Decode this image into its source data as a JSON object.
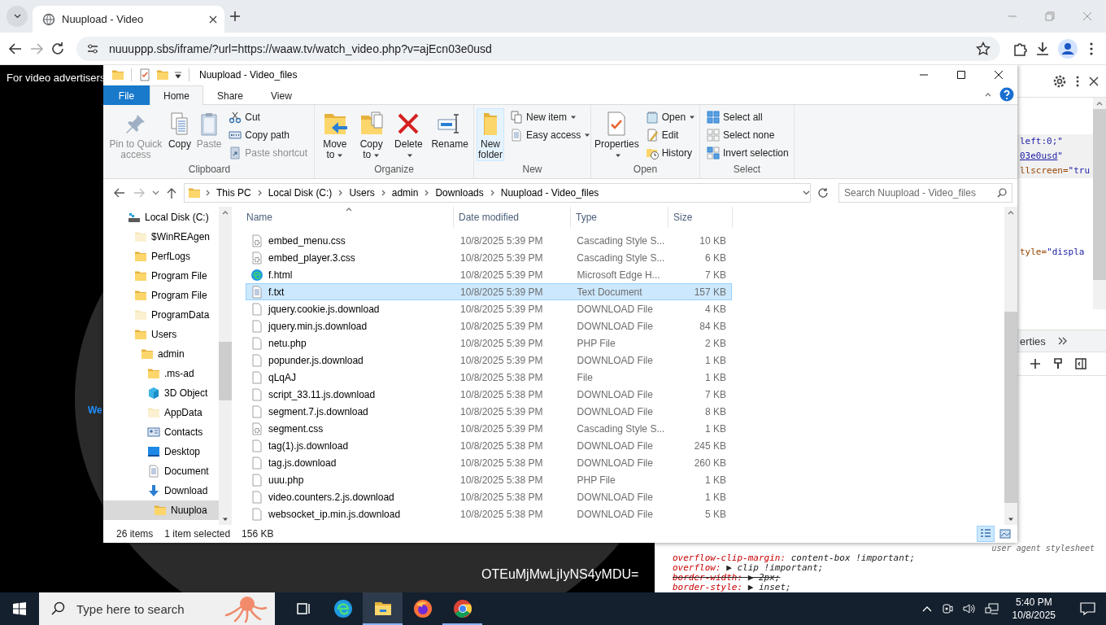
{
  "browser": {
    "tab": {
      "title": "Nuupload - Video"
    },
    "url": "nuuuppp.sbs/iframe/?url=https://waaw.tv/watch_video.php?v=ajEcn03e0usd"
  },
  "page": {
    "banner": "For video advertisers",
    "side_text": "We",
    "footer_code": "OTEuMjMwLjIyNS4yMDU="
  },
  "explorer": {
    "title": "Nuupload - Video_files",
    "tabs": [
      {
        "label": "File",
        "kind": "file",
        "selected": false
      },
      {
        "label": "Home",
        "kind": "normal",
        "selected": true
      },
      {
        "label": "Share",
        "kind": "normal",
        "selected": false
      },
      {
        "label": "View",
        "kind": "normal",
        "selected": false
      }
    ],
    "ribbon": [
      {
        "title": "Clipboard",
        "items": [
          {
            "label": "Pin to Quick access",
            "kind": "large",
            "disabled": true,
            "highlighted": false,
            "dropdown": false
          },
          {
            "label": "Copy",
            "kind": "large",
            "disabled": false,
            "highlighted": false,
            "dropdown": false
          },
          {
            "label": "Paste",
            "kind": "large",
            "disabled": true,
            "highlighted": false,
            "dropdown": false
          },
          {
            "label": "Cut",
            "kind": "small",
            "disabled": false,
            "highlighted": false,
            "dropdown": false
          },
          {
            "label": "Copy path",
            "kind": "small",
            "disabled": false,
            "highlighted": false,
            "dropdown": false
          },
          {
            "label": "Paste shortcut",
            "kind": "small",
            "disabled": true,
            "highlighted": false,
            "dropdown": false
          }
        ]
      },
      {
        "title": "Organize",
        "items": [
          {
            "label": "Move to",
            "kind": "large",
            "disabled": false,
            "highlighted": false,
            "dropdown": true
          },
          {
            "label": "Copy to",
            "kind": "large",
            "disabled": false,
            "highlighted": false,
            "dropdown": true
          },
          {
            "label": "Delete",
            "kind": "large",
            "disabled": false,
            "highlighted": false,
            "dropdown": true
          },
          {
            "label": "Rename",
            "kind": "large",
            "disabled": false,
            "highlighted": false,
            "dropdown": false
          }
        ]
      },
      {
        "title": "New",
        "items": [
          {
            "label": "New folder",
            "kind": "large",
            "disabled": false,
            "highlighted": true,
            "dropdown": false
          },
          {
            "label": "New item",
            "kind": "small",
            "disabled": false,
            "highlighted": false,
            "dropdown": true
          },
          {
            "label": "Easy access",
            "kind": "small",
            "disabled": false,
            "highlighted": false,
            "dropdown": true
          }
        ]
      },
      {
        "title": "Open",
        "items": [
          {
            "label": "Properties",
            "kind": "large",
            "disabled": false,
            "highlighted": false,
            "dropdown": true
          },
          {
            "label": "Open",
            "kind": "small",
            "disabled": false,
            "highlighted": false,
            "dropdown": true
          },
          {
            "label": "Edit",
            "kind": "small",
            "disabled": false,
            "highlighted": false,
            "dropdown": false
          },
          {
            "label": "History",
            "kind": "small",
            "disabled": false,
            "highlighted": false,
            "dropdown": false
          }
        ]
      },
      {
        "title": "Select",
        "items": [
          {
            "label": "Select all",
            "kind": "small",
            "disabled": false,
            "highlighted": false,
            "dropdown": false
          },
          {
            "label": "Select none",
            "kind": "small",
            "disabled": false,
            "highlighted": false,
            "dropdown": false
          },
          {
            "label": "Invert selection",
            "kind": "small",
            "disabled": false,
            "highlighted": false,
            "dropdown": false
          }
        ]
      }
    ],
    "breadcrumbs": [
      "This PC",
      "Local Disk (C:)",
      "Users",
      "admin",
      "Downloads",
      "Nuupload - Video_files"
    ],
    "search": {
      "placeholder": "Search Nuupload - Video_files"
    },
    "nav": [
      {
        "label": "Local Disk (C:)",
        "kind": "drive",
        "selected": false,
        "children": [
          {
            "label": "$WinREAgen",
            "kind": "hidden-folder",
            "selected": false
          },
          {
            "label": "PerfLogs",
            "kind": "folder",
            "selected": false
          },
          {
            "label": "Program File",
            "kind": "folder",
            "selected": false
          },
          {
            "label": "Program File",
            "kind": "folder",
            "selected": false
          },
          {
            "label": "ProgramData",
            "kind": "hidden-folder",
            "selected": false
          },
          {
            "label": "Users",
            "kind": "folder",
            "selected": false,
            "children": [
              {
                "label": "admin",
                "kind": "folder",
                "selected": false,
                "children": [
                  {
                    "label": ".ms-ad",
                    "kind": "folder",
                    "selected": false
                  },
                  {
                    "label": "3D Object",
                    "kind": "cube",
                    "selected": false
                  },
                  {
                    "label": "AppData",
                    "kind": "hidden-folder",
                    "selected": false
                  },
                  {
                    "label": "Contacts",
                    "kind": "contacts",
                    "selected": false
                  },
                  {
                    "label": "Desktop",
                    "kind": "desktop",
                    "selected": false
                  },
                  {
                    "label": "Document",
                    "kind": "documents",
                    "selected": false
                  },
                  {
                    "label": "Download",
                    "kind": "downloads",
                    "selected": false,
                    "children": [
                      {
                        "label": "Nuuploa",
                        "kind": "folder",
                        "selected": true
                      }
                    ]
                  }
                ]
              }
            ]
          }
        ]
      }
    ],
    "columns": [
      {
        "label": "Name",
        "sorted": true
      },
      {
        "label": "Date modified",
        "sorted": false
      },
      {
        "label": "Type",
        "sorted": false
      },
      {
        "label": "Size",
        "sorted": false
      }
    ],
    "files": [
      {
        "name": "embed_menu.css",
        "date": "10/8/2025 5:39 PM",
        "type": "Cascading Style S...",
        "size": "10 KB",
        "kind": "css",
        "selected": false
      },
      {
        "name": "embed_player.3.css",
        "date": "10/8/2025 5:39 PM",
        "type": "Cascading Style S...",
        "size": "6 KB",
        "kind": "css",
        "selected": false
      },
      {
        "name": "f.html",
        "date": "10/8/2025 5:39 PM",
        "type": "Microsoft Edge H...",
        "size": "7 KB",
        "kind": "edge",
        "selected": false
      },
      {
        "name": "f.txt",
        "date": "10/8/2025 5:39 PM",
        "type": "Text Document",
        "size": "157 KB",
        "kind": "text",
        "selected": true
      },
      {
        "name": "jquery.cookie.js.download",
        "date": "10/8/2025 5:39 PM",
        "type": "DOWNLOAD File",
        "size": "4 KB",
        "kind": "blank",
        "selected": false
      },
      {
        "name": "jquery.min.js.download",
        "date": "10/8/2025 5:39 PM",
        "type": "DOWNLOAD File",
        "size": "84 KB",
        "kind": "blank",
        "selected": false
      },
      {
        "name": "netu.php",
        "date": "10/8/2025 5:39 PM",
        "type": "PHP File",
        "size": "2 KB",
        "kind": "blank",
        "selected": false
      },
      {
        "name": "popunder.js.download",
        "date": "10/8/2025 5:39 PM",
        "type": "DOWNLOAD File",
        "size": "1 KB",
        "kind": "blank",
        "selected": false
      },
      {
        "name": "qLqAJ",
        "date": "10/8/2025 5:38 PM",
        "type": "File",
        "size": "1 KB",
        "kind": "blank",
        "selected": false
      },
      {
        "name": "script_33.11.js.download",
        "date": "10/8/2025 5:38 PM",
        "type": "DOWNLOAD File",
        "size": "7 KB",
        "kind": "blank",
        "selected": false
      },
      {
        "name": "segment.7.js.download",
        "date": "10/8/2025 5:39 PM",
        "type": "DOWNLOAD File",
        "size": "8 KB",
        "kind": "blank",
        "selected": false
      },
      {
        "name": "segment.css",
        "date": "10/8/2025 5:39 PM",
        "type": "Cascading Style S...",
        "size": "1 KB",
        "kind": "css",
        "selected": false
      },
      {
        "name": "tag(1).js.download",
        "date": "10/8/2025 5:38 PM",
        "type": "DOWNLOAD File",
        "size": "245 KB",
        "kind": "blank",
        "selected": false
      },
      {
        "name": "tag.js.download",
        "date": "10/8/2025 5:38 PM",
        "type": "DOWNLOAD File",
        "size": "260 KB",
        "kind": "blank",
        "selected": false
      },
      {
        "name": "uuu.php",
        "date": "10/8/2025 5:38 PM",
        "type": "PHP File",
        "size": "1 KB",
        "kind": "blank",
        "selected": false
      },
      {
        "name": "video.counters.2.js.download",
        "date": "10/8/2025 5:38 PM",
        "type": "DOWNLOAD File",
        "size": "1 KB",
        "kind": "blank",
        "selected": false
      },
      {
        "name": "websocket_ip.min.js.download",
        "date": "10/8/2025 5:38 PM",
        "type": "DOWNLOAD File",
        "size": "5 KB",
        "kind": "blank",
        "selected": false
      }
    ],
    "status": {
      "item_count": "26 items",
      "selection": "1 item selected",
      "selection_size": "156 KB"
    },
    "views": [
      {
        "kind": "details",
        "selected": true
      },
      {
        "kind": "large-icons",
        "selected": false
      }
    ]
  },
  "devtools": {
    "code_lines": [
      {
        "kind": "highlighted",
        "parts": [
          {
            "text": "left:0;\"",
            "kind": "value"
          }
        ]
      },
      {
        "kind": "highlighted",
        "parts": [
          {
            "text": "03e0usd",
            "kind": "link"
          },
          {
            "text": "\"",
            "kind": "value"
          }
        ]
      },
      {
        "kind": "highlighted",
        "parts": [
          {
            "text": "llscreen=",
            "kind": "attr"
          },
          {
            "text": "\"tru",
            "kind": "value"
          }
        ]
      },
      {
        "kind": "plain",
        "parts": [
          {
            "text": "tyle=",
            "kind": "attr"
          },
          {
            "text": "\"displa",
            "kind": "value"
          }
        ]
      }
    ],
    "panel_tab": "erties",
    "rule_source": "user agent stylesheet",
    "declarations": [
      {
        "property": "overflow-clip-margin:",
        "value": "content-box !important;",
        "overridden": false
      },
      {
        "property": "overflow:",
        "value": "▶ clip !important;",
        "overridden": false
      },
      {
        "property": "border-width:",
        "value": "▶ 2px;",
        "overridden": true
      },
      {
        "property": "border-style:",
        "value": "▶ inset;",
        "overridden": false
      }
    ]
  },
  "taskbar": {
    "search_placeholder": "Type here to search",
    "apps": [
      {
        "kind": "task-view",
        "active": false
      },
      {
        "kind": "edge",
        "active": false
      },
      {
        "kind": "explorer",
        "active": true
      },
      {
        "kind": "firefox",
        "active": false
      },
      {
        "kind": "chrome",
        "active": true
      }
    ],
    "time": "5:40 PM",
    "date": "10/8/2025"
  }
}
